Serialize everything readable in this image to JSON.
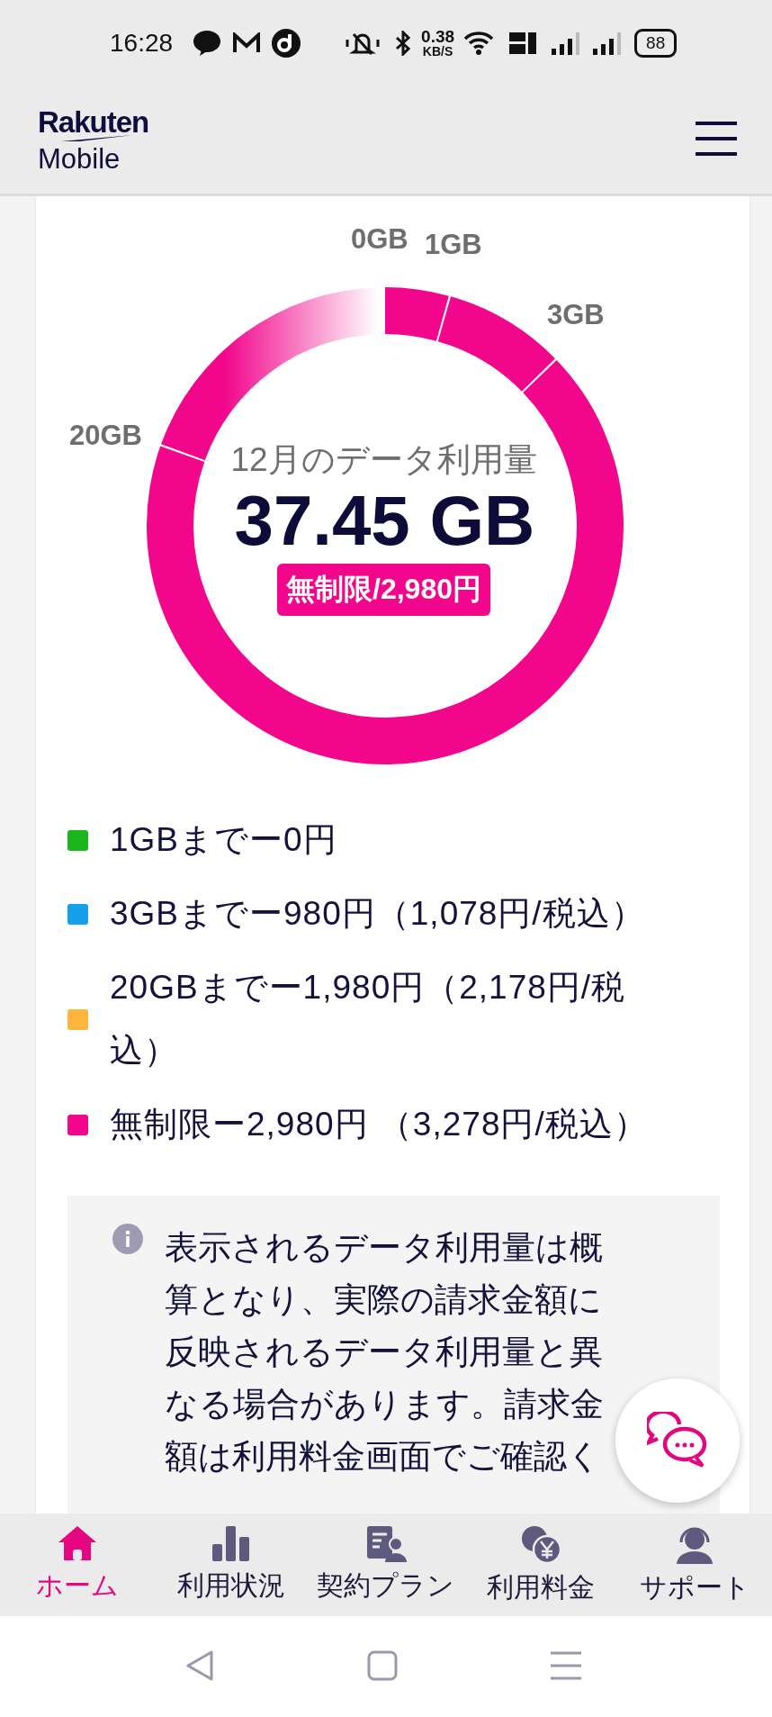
{
  "status_bar": {
    "time": "16:28",
    "net_speed": "0.38",
    "net_unit": "KB/S",
    "battery": "88"
  },
  "header": {
    "logo_top": "Rakuten",
    "logo_bottom": "Mobile"
  },
  "usage": {
    "tick_labels": [
      "0GB",
      "1GB",
      "3GB",
      "20GB"
    ],
    "title": "12月のデータ利用量",
    "amount": "37.45 GB",
    "plan_badge": "無制限/2,980円"
  },
  "legend": [
    {
      "label": "1GBまでー0円",
      "color": "#1db51d"
    },
    {
      "label": "3GBまでー980円（1,078円/税込）",
      "color": "#14a0ea"
    },
    {
      "label": "20GBまでー1,980円（2,178円/税込）",
      "color": "#ffb43c"
    },
    {
      "label": "無制限ー2,980円 （3,278円/税込）",
      "color": "#f2078c"
    }
  ],
  "notice": "表示されるデータ利用量は概算となり、実際の請求金額に反映されるデータ利用量と異なる場合があります。請求金額は利用料金画面でご確認く",
  "bottom_nav": [
    {
      "label": "ホーム",
      "selected": true
    },
    {
      "label": "利用状況",
      "selected": false
    },
    {
      "label": "契約プラン",
      "selected": false
    },
    {
      "label": "利用料金",
      "selected": false
    },
    {
      "label": "サポート",
      "selected": false
    }
  ]
}
